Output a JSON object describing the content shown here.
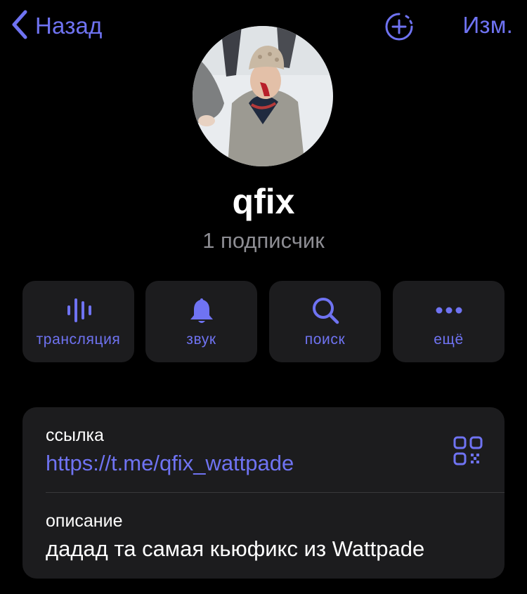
{
  "nav": {
    "back_label": "Назад",
    "edit_label": "Изм.",
    "accent_color": "#6f73f2"
  },
  "profile": {
    "name": "qfix",
    "subscribers": "1 подписчик",
    "avatar": "photo"
  },
  "actions": [
    {
      "label": "трансляция",
      "icon": "waveform-icon"
    },
    {
      "label": "звук",
      "icon": "bell-icon"
    },
    {
      "label": "поиск",
      "icon": "search-icon"
    },
    {
      "label": "ещё",
      "icon": "more-icon"
    }
  ],
  "info": {
    "link_title": "ссылка",
    "link_value": "https://t.me/qfix_wattpade",
    "description_title": "описание",
    "description_value": "дадад та самая кьюфикс из Wattpade"
  }
}
